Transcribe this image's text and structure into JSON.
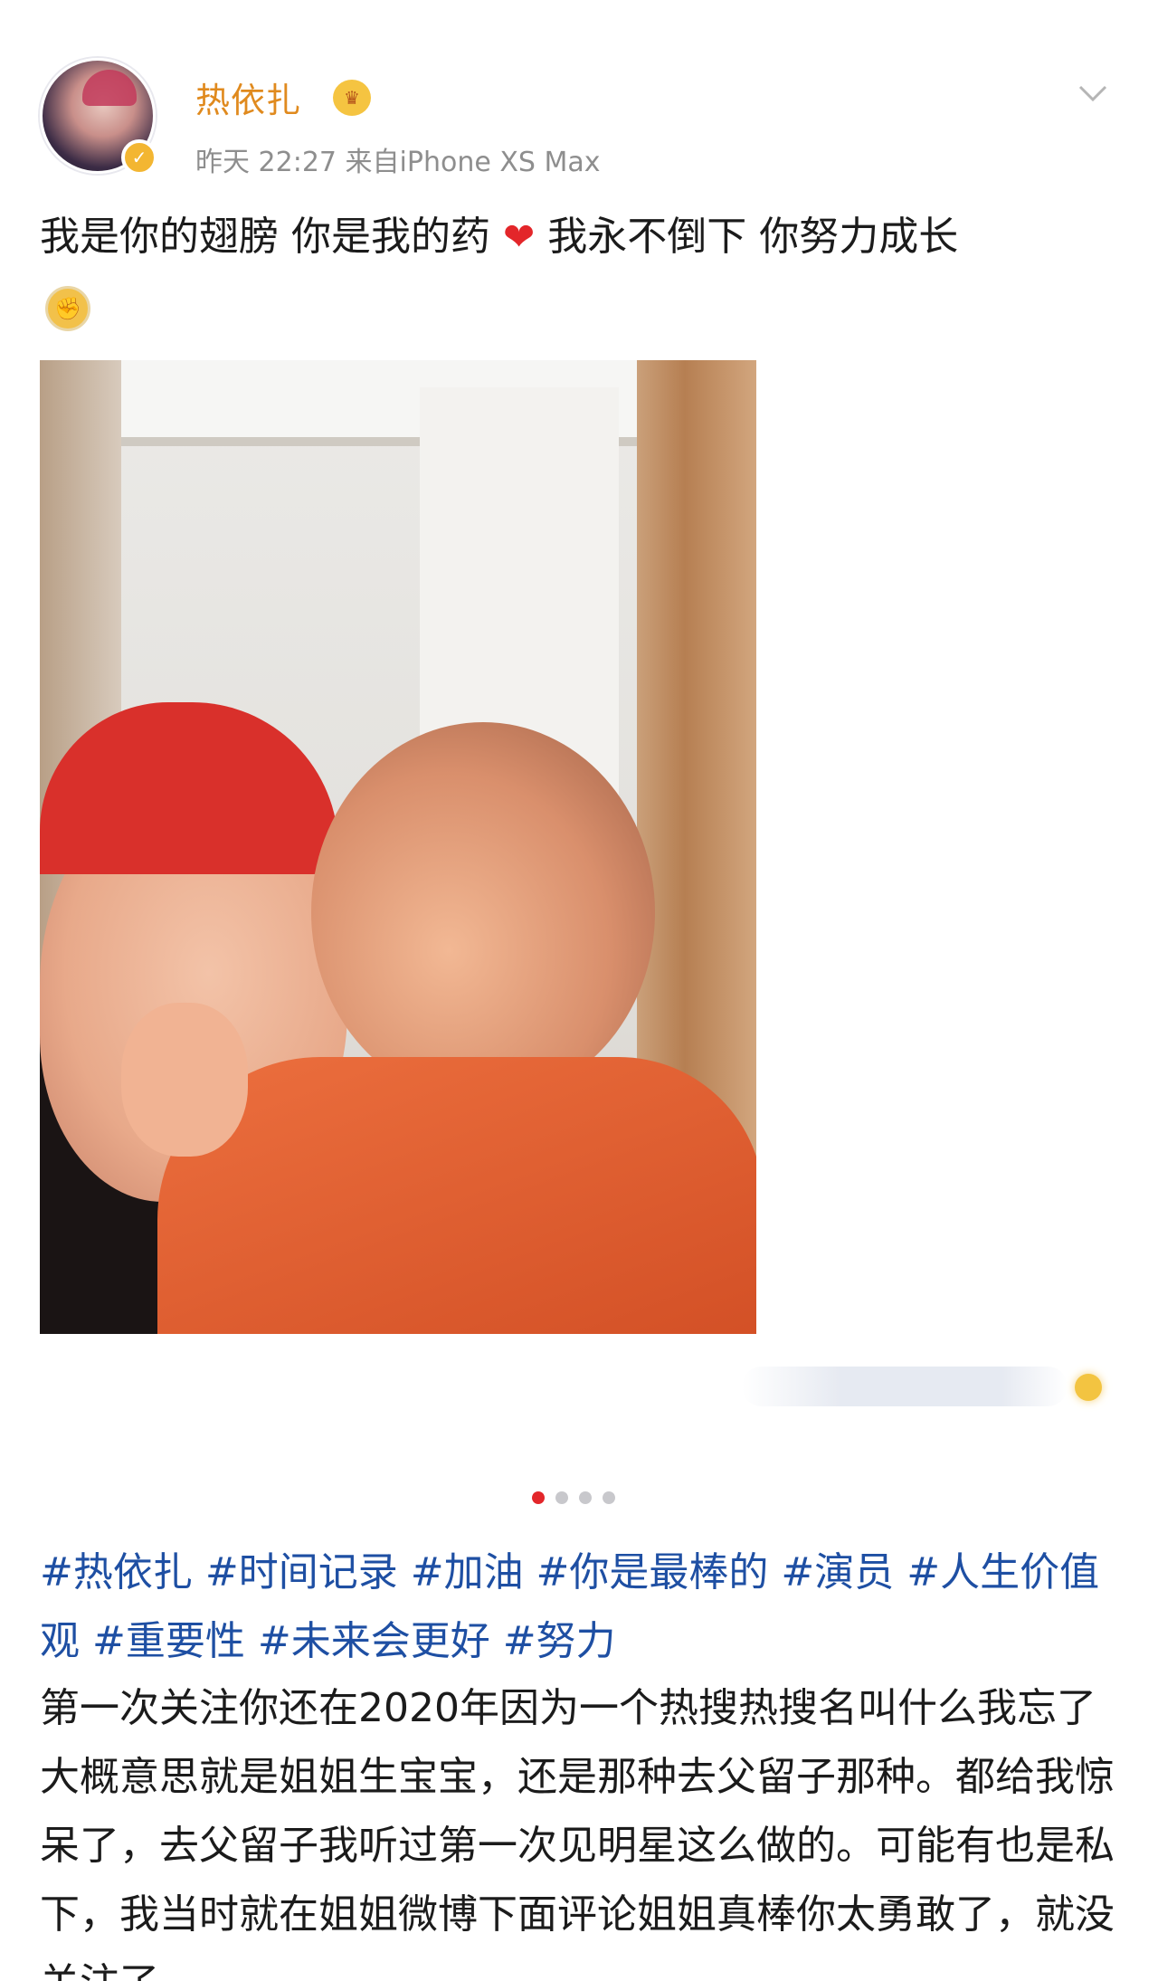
{
  "post": {
    "username": "热依扎",
    "time": "昨天 22:27",
    "source": "来自iPhone XS Max",
    "text_line1_a": "我是你的翅膀 你是我的药",
    "text_line1_b": "我永不倒下 你努力成长"
  },
  "icons": {
    "avatar": "avatar",
    "verified": "verified-badge-icon",
    "level": "user-level-icon",
    "heart": "heart-icon",
    "emoji": "emoji-icon",
    "more": "chevron-down-icon",
    "coin": "coin-icon"
  },
  "colors": {
    "username": "#e08a1e",
    "hashtag": "#1e4fa3",
    "heart": "#e3262a",
    "active_dot": "#e3262a"
  },
  "pager": {
    "count": 4,
    "active_index": 0
  },
  "caption": {
    "hashtags": "#热依扎 #时间记录 #加油 #你是最棒的 #演员 #人生价值观 #重要性 #未来会更好  #努力",
    "body": "第一次关注你还在2020年因为一个热搜热搜名叫什么我忘了大概意思就是姐姐生宝宝，还是那种去父留子那种。都给我惊呆了，去父留子我听过第一次见明星这么做的。可能有也是私下，我当时就在姐姐微博下面评论姐姐真棒你太勇敢了，就没关注了"
  }
}
